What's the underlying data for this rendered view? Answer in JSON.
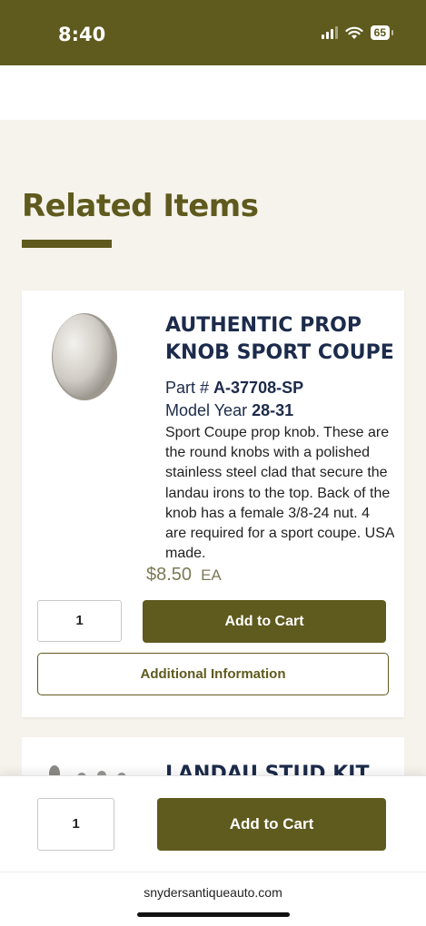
{
  "status_bar": {
    "time": "8:40",
    "battery": "65"
  },
  "section": {
    "title": "Related Items"
  },
  "product": {
    "title": "AUTHENTIC PROP KNOB SPORT COUPE",
    "part_label": "Part #",
    "part_number": "A-37708-SP",
    "year_label": "Model Year",
    "year": "28-31",
    "description": "Sport Coupe prop knob.  These are the round knobs with a polished stainless steel clad that secure the landau irons to the top.  Back of the knob has a female 3/8-24 nut.  4 are required for a sport coupe.  USA made.",
    "price": "$8.50",
    "unit": "EA",
    "quantity": "1",
    "add_to_cart_label": "Add to Cart",
    "additional_info_label": "Additional Information"
  },
  "next_product": {
    "title": "LANDAU STUD KIT"
  },
  "sticky_bar": {
    "quantity": "1",
    "add_to_cart_label": "Add to Cart"
  },
  "browser": {
    "url": "snydersantiqueauto.com"
  },
  "colors": {
    "brand": "#5f5a1d",
    "title_navy": "#1c2b4b",
    "background": "#f6f3ec"
  }
}
